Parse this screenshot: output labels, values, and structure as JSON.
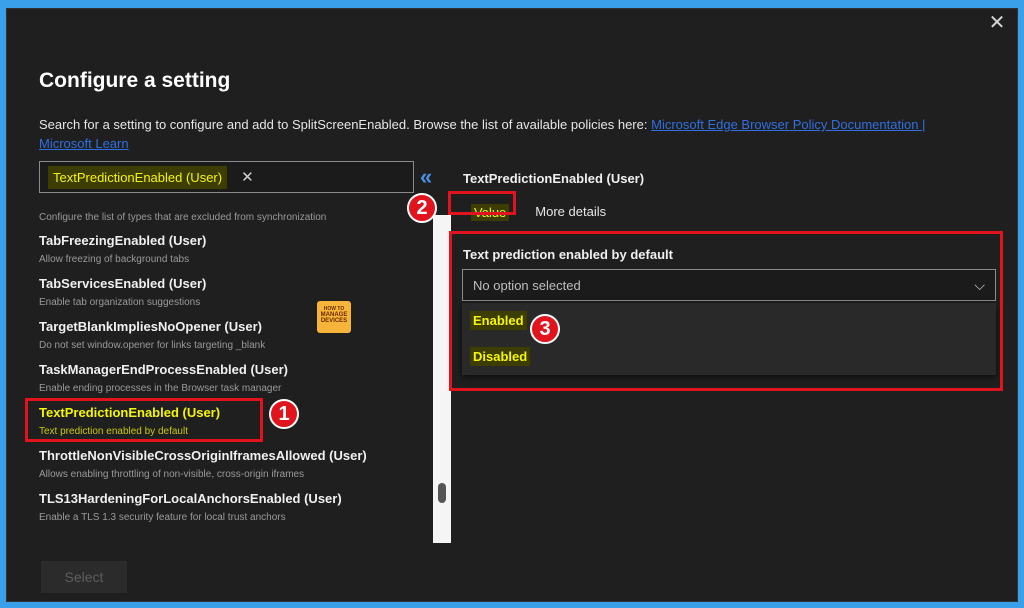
{
  "dialog": {
    "close_label": "✕",
    "title": "Configure a setting",
    "description": "Search for a setting to configure and add to SplitScreenEnabled. Browse the list of available policies here:",
    "link_text": "Microsoft Edge Browser Policy Documentation | Microsoft Learn"
  },
  "search": {
    "value": "TextPredictionEnabled (User)",
    "clear_label": "✕",
    "collapse_label": "«"
  },
  "list": {
    "header_desc": "Configure the list of types that are excluded from synchronization",
    "items": [
      {
        "name": "TabFreezingEnabled (User)",
        "desc": "Allow freezing of background tabs"
      },
      {
        "name": "TabServicesEnabled (User)",
        "desc": "Enable tab organization suggestions"
      },
      {
        "name": "TargetBlankImpliesNoOpener (User)",
        "desc": "Do not set window.opener for links targeting _blank"
      },
      {
        "name": "TaskManagerEndProcessEnabled (User)",
        "desc": "Enable ending processes in the Browser task manager"
      },
      {
        "name": "TextPredictionEnabled (User)",
        "desc": "Text prediction enabled by default"
      },
      {
        "name": "ThrottleNonVisibleCrossOriginIframesAllowed (User)",
        "desc": "Allows enabling throttling of non-visible, cross-origin iframes"
      },
      {
        "name": "TLS13HardeningForLocalAnchorsEnabled (User)",
        "desc": "Enable a TLS 1.3 security feature for local trust anchors"
      }
    ]
  },
  "logo": {
    "line1": "HOW TO",
    "line2": "MANAGE",
    "line3": "DEVICES"
  },
  "badges": {
    "one": "1",
    "two": "2",
    "three": "3"
  },
  "detail": {
    "title": "TextPredictionEnabled (User)",
    "tabs": {
      "value": "Value",
      "more": "More details"
    },
    "field_label": "Text prediction enabled by default",
    "dropdown_placeholder": "No option selected",
    "chevron": "⌵",
    "options": [
      "Enabled",
      "Disabled"
    ]
  },
  "footer": {
    "select_label": "Select"
  },
  "colors": {
    "highlight": "#f6f600",
    "annotation_red": "#e1141e",
    "accent": "#4a8fe6"
  }
}
